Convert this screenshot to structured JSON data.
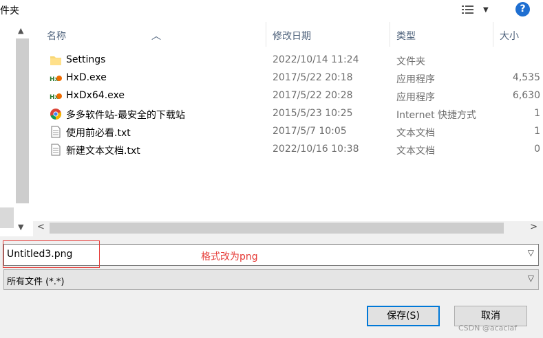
{
  "window": {
    "title": "件夹"
  },
  "columns": {
    "name": "名称",
    "date": "修改日期",
    "type": "类型",
    "size": "大小"
  },
  "files": [
    {
      "name": "Settings",
      "date": "2022/10/14 11:24",
      "type": "文件夹",
      "size": "",
      "icon": "folder-icon"
    },
    {
      "name": "HxD.exe",
      "date": "2017/5/22 20:18",
      "type": "应用程序",
      "size": "4,535",
      "icon": "hxd-app-icon"
    },
    {
      "name": "HxDx64.exe",
      "date": "2017/5/22 20:28",
      "type": "应用程序",
      "size": "6,630",
      "icon": "hxd-app-icon"
    },
    {
      "name": "多多软件站-最安全的下载站",
      "date": "2015/5/23 10:25",
      "type": "Internet 快捷方式",
      "size": "1",
      "icon": "chrome-icon"
    },
    {
      "name": "使用前必看.txt",
      "date": "2017/5/7 10:05",
      "type": "文本文档",
      "size": "1",
      "icon": "text-file-icon"
    },
    {
      "name": "新建文本文档.txt",
      "date": "2022/10/16 10:38",
      "type": "文本文档",
      "size": "0",
      "icon": "text-file-icon"
    }
  ],
  "filename": {
    "value": "Untitled3.png"
  },
  "annotation": "格式改为png",
  "filetype": {
    "value": "所有文件 (*.*)"
  },
  "buttons": {
    "save": "保存(S)",
    "cancel": "取消"
  },
  "watermark": "CSDN @acaciaf",
  "colors": {
    "accent": "#0078d7",
    "annotation": "#e53935"
  }
}
